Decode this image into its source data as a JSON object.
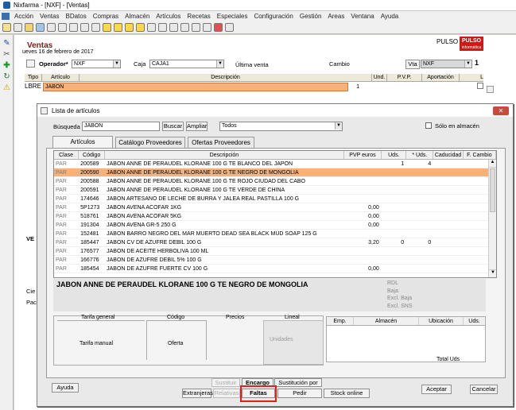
{
  "window": {
    "title": "Nixfarma - [NXF] - [Ventas]"
  },
  "menu": [
    "Acción",
    "Ventas",
    "BDatos",
    "Compras",
    "Almacén",
    "Artículos",
    "Recetas",
    "Especiales",
    "Configuración",
    "Gestión",
    "Areas",
    "Ventana",
    "Ayuda"
  ],
  "ventas": {
    "title": "Ventas",
    "date": "ueves 16 de febrero de 2017",
    "pulso_text": "PULSO",
    "pulso_logo": "PULSO",
    "pulso_logo_sub": "informática",
    "operador_label": "Operador*",
    "operador_value": "NXF",
    "caja_label": "Caja",
    "caja_value": "CAJA1",
    "ultima_venta_label": "Última venta",
    "cambio_label": "Cambio",
    "vta_label": "Vta",
    "vta_value": "NXF",
    "vta_number": "1",
    "grid_headers": [
      "Tipo",
      "Artículo",
      "Descripción",
      "Und.",
      "P.V.P.",
      "Aportación",
      "L"
    ],
    "grid_row": {
      "tipo": "LBRE",
      "articulo": "JABON",
      "und": "1"
    },
    "ve_label": "VE",
    "cie_label": "Cie",
    "pac_label": "Pac"
  },
  "dialog": {
    "title": "Lista de artículos",
    "busqueda_label": "Búsqueda",
    "busqueda_value": "JABON",
    "buscar_button": "Buscar",
    "ampliar_button": "Ampliar",
    "filter_value": "Todos",
    "solo_almacen_label": "Sólo en almacén",
    "tabs": [
      "Artículos",
      "Catálogo Proveedores",
      "Ofertas Proveedores"
    ],
    "columns": [
      "Clase",
      "Código",
      "Descripción",
      "PVP euros",
      "Uds.",
      "* Uds.",
      "Caducidad",
      "F. Cambio"
    ],
    "rows": [
      {
        "clase": "PAR",
        "codigo": "200589",
        "descripcion": "JABON ANNE DE PERAUDEL KLORANE 100 G TE BLANCO DEL JAPON",
        "pvp": "",
        "uds": "1",
        "uds2": "4"
      },
      {
        "clase": "PAR",
        "codigo": "200590",
        "descripcion": "JABON ANNE DE PERAUDEL KLORANE 100 G TE NEGRO DE MONGOLIA",
        "pvp": "",
        "uds": "",
        "uds2": ""
      },
      {
        "clase": "PAR",
        "codigo": "200588",
        "descripcion": "JABON ANNE DE PERAUDEL KLORANE 100 G TE ROJO CIUDAD DEL CABO",
        "pvp": "",
        "uds": "",
        "uds2": ""
      },
      {
        "clase": "PAR",
        "codigo": "200591",
        "descripcion": "JABON ANNE DE PERAUDEL KLORANE 100 G TE VERDE DE CHINA",
        "pvp": "",
        "uds": "",
        "uds2": ""
      },
      {
        "clase": "PAR",
        "codigo": "174646",
        "descripcion": "JABON ARTESANO DE LECHE DE BURRA Y JALEA REAL  PASTILLA 100 G",
        "pvp": "",
        "uds": "",
        "uds2": ""
      },
      {
        "clase": "PAR",
        "codigo": "5P1273",
        "descripcion": "JABON AVENA          ACOFAR  1KG",
        "pvp": "0,00",
        "uds": "",
        "uds2": ""
      },
      {
        "clase": "PAR",
        "codigo": "518761",
        "descripcion": "JABON AVENA          ACOFAR  5KG",
        "pvp": "0,00",
        "uds": "",
        "uds2": ""
      },
      {
        "clase": "PAR",
        "codigo": "191304",
        "descripcion": "JABON AVENA GR-5  250 G",
        "pvp": "0,00",
        "uds": "",
        "uds2": ""
      },
      {
        "clase": "PAR",
        "codigo": "152481",
        "descripcion": "JABON BARRO NEGRO DEL MAR MUERTO DEAD SEA BLACK MUD SOAP 125 G",
        "pvp": "",
        "uds": "",
        "uds2": ""
      },
      {
        "clase": "PAR",
        "codigo": "185447",
        "descripcion": "JABON CV DE AZUFRE DEBIL  100 G",
        "pvp": "3,20",
        "uds": "0",
        "uds2": "0"
      },
      {
        "clase": "PAR",
        "codigo": "176577",
        "descripcion": "JABON DE ACEITE HERBOLIVA  100 ML",
        "pvp": "",
        "uds": "",
        "uds2": ""
      },
      {
        "clase": "PAR",
        "codigo": "166776",
        "descripcion": "JABON DE AZUFRE DEBIL 5%  100 G",
        "pvp": "",
        "uds": "",
        "uds2": ""
      },
      {
        "clase": "PAR",
        "codigo": "185454",
        "descripcion": "JABON DE AZUFRE FUERTE CV 100 G",
        "pvp": "0,00",
        "uds": "",
        "uds2": ""
      }
    ],
    "selected_description": "JABON ANNE DE PERAUDEL KLORANE 100 G TE NEGRO DE MONGOLIA",
    "flags": [
      "RDL",
      "Baja",
      "Excl. Baja",
      "Excl. SNS"
    ],
    "prices": {
      "tarifa_general": "Tarifa general",
      "codigo": "Código",
      "precios": "Precios",
      "lineal": "Lineal",
      "tarifa_manual": "Tarifa manual",
      "oferta": "Oferta",
      "unidades": "Unidades"
    },
    "stock_headers": [
      "Emp.",
      "Almacén",
      "Ubicación",
      "Uds."
    ],
    "total_uds_label": "Total Uds",
    "buttons": {
      "ayuda": "Ayuda",
      "sustituir": "Sustituir",
      "encargo": "Encargo",
      "sustitucion_ah": "Sustitución por AH",
      "extranjeras": "Extranjeras",
      "relativas": "Relativas",
      "faltas": "Faltas",
      "pedir": "Pedir",
      "stock_online": "Stock online",
      "aceptar": "Aceptar",
      "cancelar": "Cancelar"
    }
  },
  "colors": {
    "selected_row": "#f7b27c",
    "highlight_box": "#e02020",
    "pulso_logo": "#d01818"
  }
}
